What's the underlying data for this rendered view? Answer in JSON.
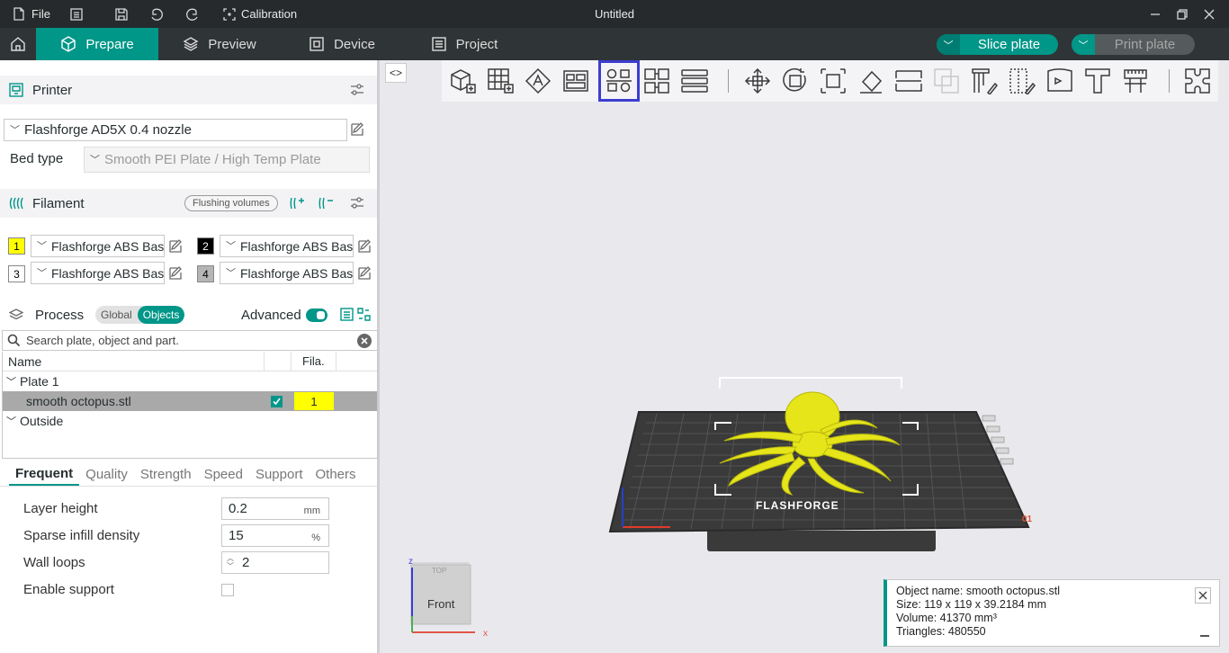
{
  "titlebar": {
    "file_label": "File",
    "calibration_label": "Calibration",
    "title": "Untitled"
  },
  "tabs": [
    {
      "label": "Prepare",
      "active": true
    },
    {
      "label": "Preview",
      "active": false
    },
    {
      "label": "Device",
      "active": false
    },
    {
      "label": "Project",
      "active": false
    }
  ],
  "actions": {
    "slice_label": "Slice plate",
    "print_label": "Print plate"
  },
  "printer": {
    "section_label": "Printer",
    "selected": "Flashforge AD5X 0.4 nozzle",
    "bed_type_label": "Bed type",
    "bed_type_value": "Smooth PEI Plate / High Temp Plate"
  },
  "filament": {
    "section_label": "Filament",
    "flushing_label": "Flushing volumes",
    "slots": [
      {
        "num": "1",
        "name": "Flashforge ABS Basic",
        "color": "#ffff00",
        "text_color": "#000000"
      },
      {
        "num": "2",
        "name": "Flashforge ABS Basic",
        "color": "#000000",
        "text_color": "#ffffff"
      },
      {
        "num": "3",
        "name": "Flashforge ABS Basic",
        "color": "#ffffff",
        "text_color": "#000000"
      },
      {
        "num": "4",
        "name": "Flashforge ABS Basic",
        "color": "#b5b5b5",
        "text_color": "#000000"
      }
    ]
  },
  "process": {
    "section_label": "Process",
    "global_label": "Global",
    "objects_label": "Objects",
    "advanced_label": "Advanced"
  },
  "search": {
    "placeholder": "Search plate, object and part."
  },
  "tree": {
    "col_name": "Name",
    "col_fila": "Fila.",
    "plate_label": "Plate 1",
    "object_label": "smooth octopus.stl",
    "object_fila": "1",
    "outside_label": "Outside"
  },
  "param_tabs": [
    "Frequent",
    "Quality",
    "Strength",
    "Speed",
    "Support",
    "Others"
  ],
  "params": {
    "layer_height_label": "Layer height",
    "layer_height_value": "0.2",
    "layer_height_unit": "mm",
    "infill_label": "Sparse infill density",
    "infill_value": "15",
    "infill_unit": "%",
    "wall_loops_label": "Wall loops",
    "wall_loops_value": "2",
    "support_label": "Enable support"
  },
  "viewport": {
    "cube_front_label": "Front",
    "cube_top_label": "TOP",
    "axis_x": "x",
    "axis_z": "z",
    "plate_brand": "FLASHFORGE",
    "plate_number": "01"
  },
  "object_info": {
    "name_line": "Object name: smooth octopus.stl",
    "size_line": "Size: 119 x 119 x 39.2184 mm",
    "volume_line": "Volume: 41370 mm³",
    "triangles_line": "Triangles: 480550"
  },
  "colors": {
    "accent": "#009688",
    "highlight": "#3d3dd1",
    "model": "#e5e51a"
  }
}
